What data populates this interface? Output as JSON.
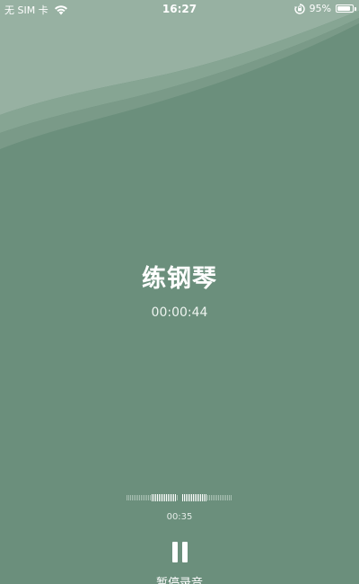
{
  "status_bar": {
    "carrier": "无 SIM 卡",
    "time": "16:27",
    "battery": "95%",
    "battery_level": 0.95,
    "icons": [
      "wifi-icon",
      "lock-rotation-icon",
      "battery-icon"
    ]
  },
  "recording": {
    "title": "练钢琴",
    "elapsed": "00:00:44"
  },
  "player": {
    "position": "00:35",
    "pause_label": "暂停录音",
    "pause_icon": "pause-icon"
  },
  "colors": {
    "background": "#6b8f7c",
    "wave_light": "#a9c0b3",
    "text": "#ffffff"
  }
}
